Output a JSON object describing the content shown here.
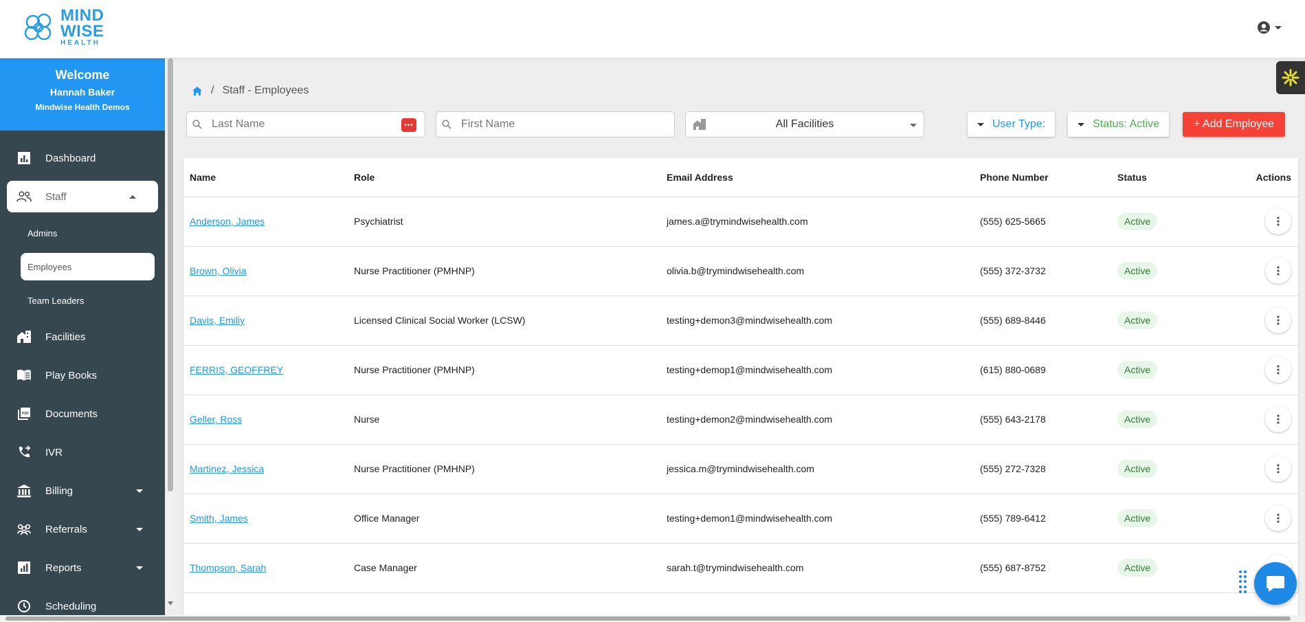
{
  "brand": {
    "line1": "MIND",
    "line2": "WISE",
    "line3": "HEALTH",
    "accent": "#2196f3"
  },
  "sidebar": {
    "welcome": "Welcome",
    "user_name": "Hannah Baker",
    "org_name": "Mindwise Health Demos",
    "items": [
      {
        "label": "Dashboard",
        "icon": "dashboard-icon"
      },
      {
        "label": "Staff",
        "icon": "staff-icon"
      },
      {
        "label": "Facilities",
        "icon": "facilities-icon"
      },
      {
        "label": "Play Books",
        "icon": "book-icon"
      },
      {
        "label": "Documents",
        "icon": "documents-icon"
      },
      {
        "label": "IVR",
        "icon": "phone-forward-icon"
      },
      {
        "label": "Billing",
        "icon": "bank-icon"
      },
      {
        "label": "Referrals",
        "icon": "referrals-icon"
      },
      {
        "label": "Reports",
        "icon": "reports-icon"
      },
      {
        "label": "Scheduling",
        "icon": "clock-icon"
      }
    ],
    "staff_sub": [
      "Admins",
      "Employees",
      "Team Leaders"
    ]
  },
  "breadcrumb": {
    "home_icon": "home-icon",
    "current": "Staff - Employees"
  },
  "filters": {
    "last_name_placeholder": "Last Name",
    "first_name_placeholder": "First Name",
    "facility": "All Facilities",
    "user_type": "User Type:",
    "status": "Status: Active",
    "add_employee": "+ Add Employee",
    "user_type_color": "#2196f3",
    "status_color": "#4caf50"
  },
  "table": {
    "headers": {
      "name": "Name",
      "role": "Role",
      "email": "Email Address",
      "phone": "Phone Number",
      "status": "Status",
      "actions": "Actions"
    },
    "rows": [
      {
        "name": "Anderson, James",
        "role": "Psychiatrist",
        "email": "james.a@trymindwisehealth.com",
        "phone": "(555) 625-5665",
        "status": "Active"
      },
      {
        "name": "Brown, Olivia",
        "role": "Nurse Practitioner (PMHNP)",
        "email": "olivia.b@trymindwisehealth.com",
        "phone": "(555) 372-3732",
        "status": "Active"
      },
      {
        "name": "Davis, Emiliy",
        "role": "Licensed Clinical Social Worker (LCSW)",
        "email": "testing+demon3@mindwisehealth.com",
        "phone": "(555) 689-8446",
        "status": "Active"
      },
      {
        "name": "FERRIS, GEOFFREY",
        "role": "Nurse Practitioner (PMHNP)",
        "email": "testing+demop1@mindwisehealth.com",
        "phone": "(615) 880-0689",
        "status": "Active"
      },
      {
        "name": "Geller, Ross",
        "role": "Nurse",
        "email": "testing+demon2@mindwisehealth.com",
        "phone": "(555) 643-2178",
        "status": "Active"
      },
      {
        "name": "Martinez, Jessica",
        "role": "Nurse Practitioner (PMHNP)",
        "email": "jessica.m@trymindwisehealth.com",
        "phone": "(555) 272-7328",
        "status": "Active"
      },
      {
        "name": "Smith, James",
        "role": "Office Manager",
        "email": "testing+demon1@mindwisehealth.com",
        "phone": "(555) 789-6412",
        "status": "Active"
      },
      {
        "name": "Thompson, Sarah",
        "role": "Case Manager",
        "email": "sarah.t@trymindwisehealth.com",
        "phone": "(555) 687-8752",
        "status": "Active"
      }
    ]
  }
}
